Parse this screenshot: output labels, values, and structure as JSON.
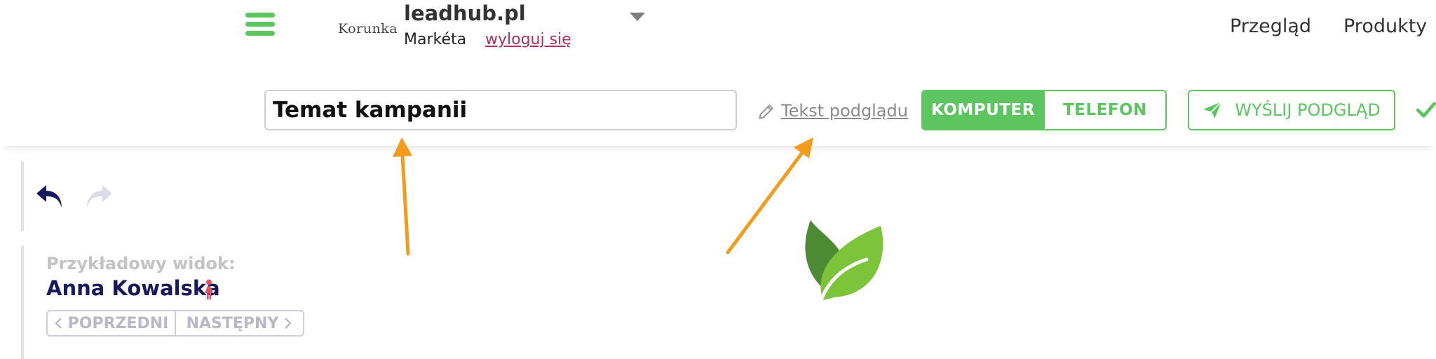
{
  "header": {
    "brand_logo_text": "Korunka",
    "site_name": "leadhub.pl",
    "user_name": "Markéta",
    "logout_label": "wyloguj się",
    "nav": [
      {
        "label": "Przegląd"
      },
      {
        "label": "Produkty"
      }
    ]
  },
  "toolbar": {
    "subject_value": "Temat kampanii",
    "preview_text_label": "Tekst podglądu",
    "device_toggle": [
      {
        "label": "KOMPUTER",
        "active": true
      },
      {
        "label": "TELEFON",
        "active": false
      }
    ],
    "send_preview_label": "WYŚLIJ PODGLĄD"
  },
  "preview_panel": {
    "sample_view_label": "Przykładowy widok:",
    "contact_name": "Anna Kowalska",
    "prev_label": "POPRZEDNI",
    "next_label": "NASTĘPNY"
  },
  "icons": [
    "hamburger-icon",
    "chevron-down-icon",
    "pencil-icon",
    "send-icon",
    "check-icon",
    "undo-icon",
    "redo-icon",
    "female-icon",
    "chevron-left-icon",
    "chevron-right-icon",
    "leaf-logo"
  ],
  "colors": {
    "accent_green": "#5cc560",
    "link_pink": "#b03060",
    "navy": "#161a5a",
    "annotation_orange": "#f29b1d",
    "female_icon": "#e0556b"
  }
}
